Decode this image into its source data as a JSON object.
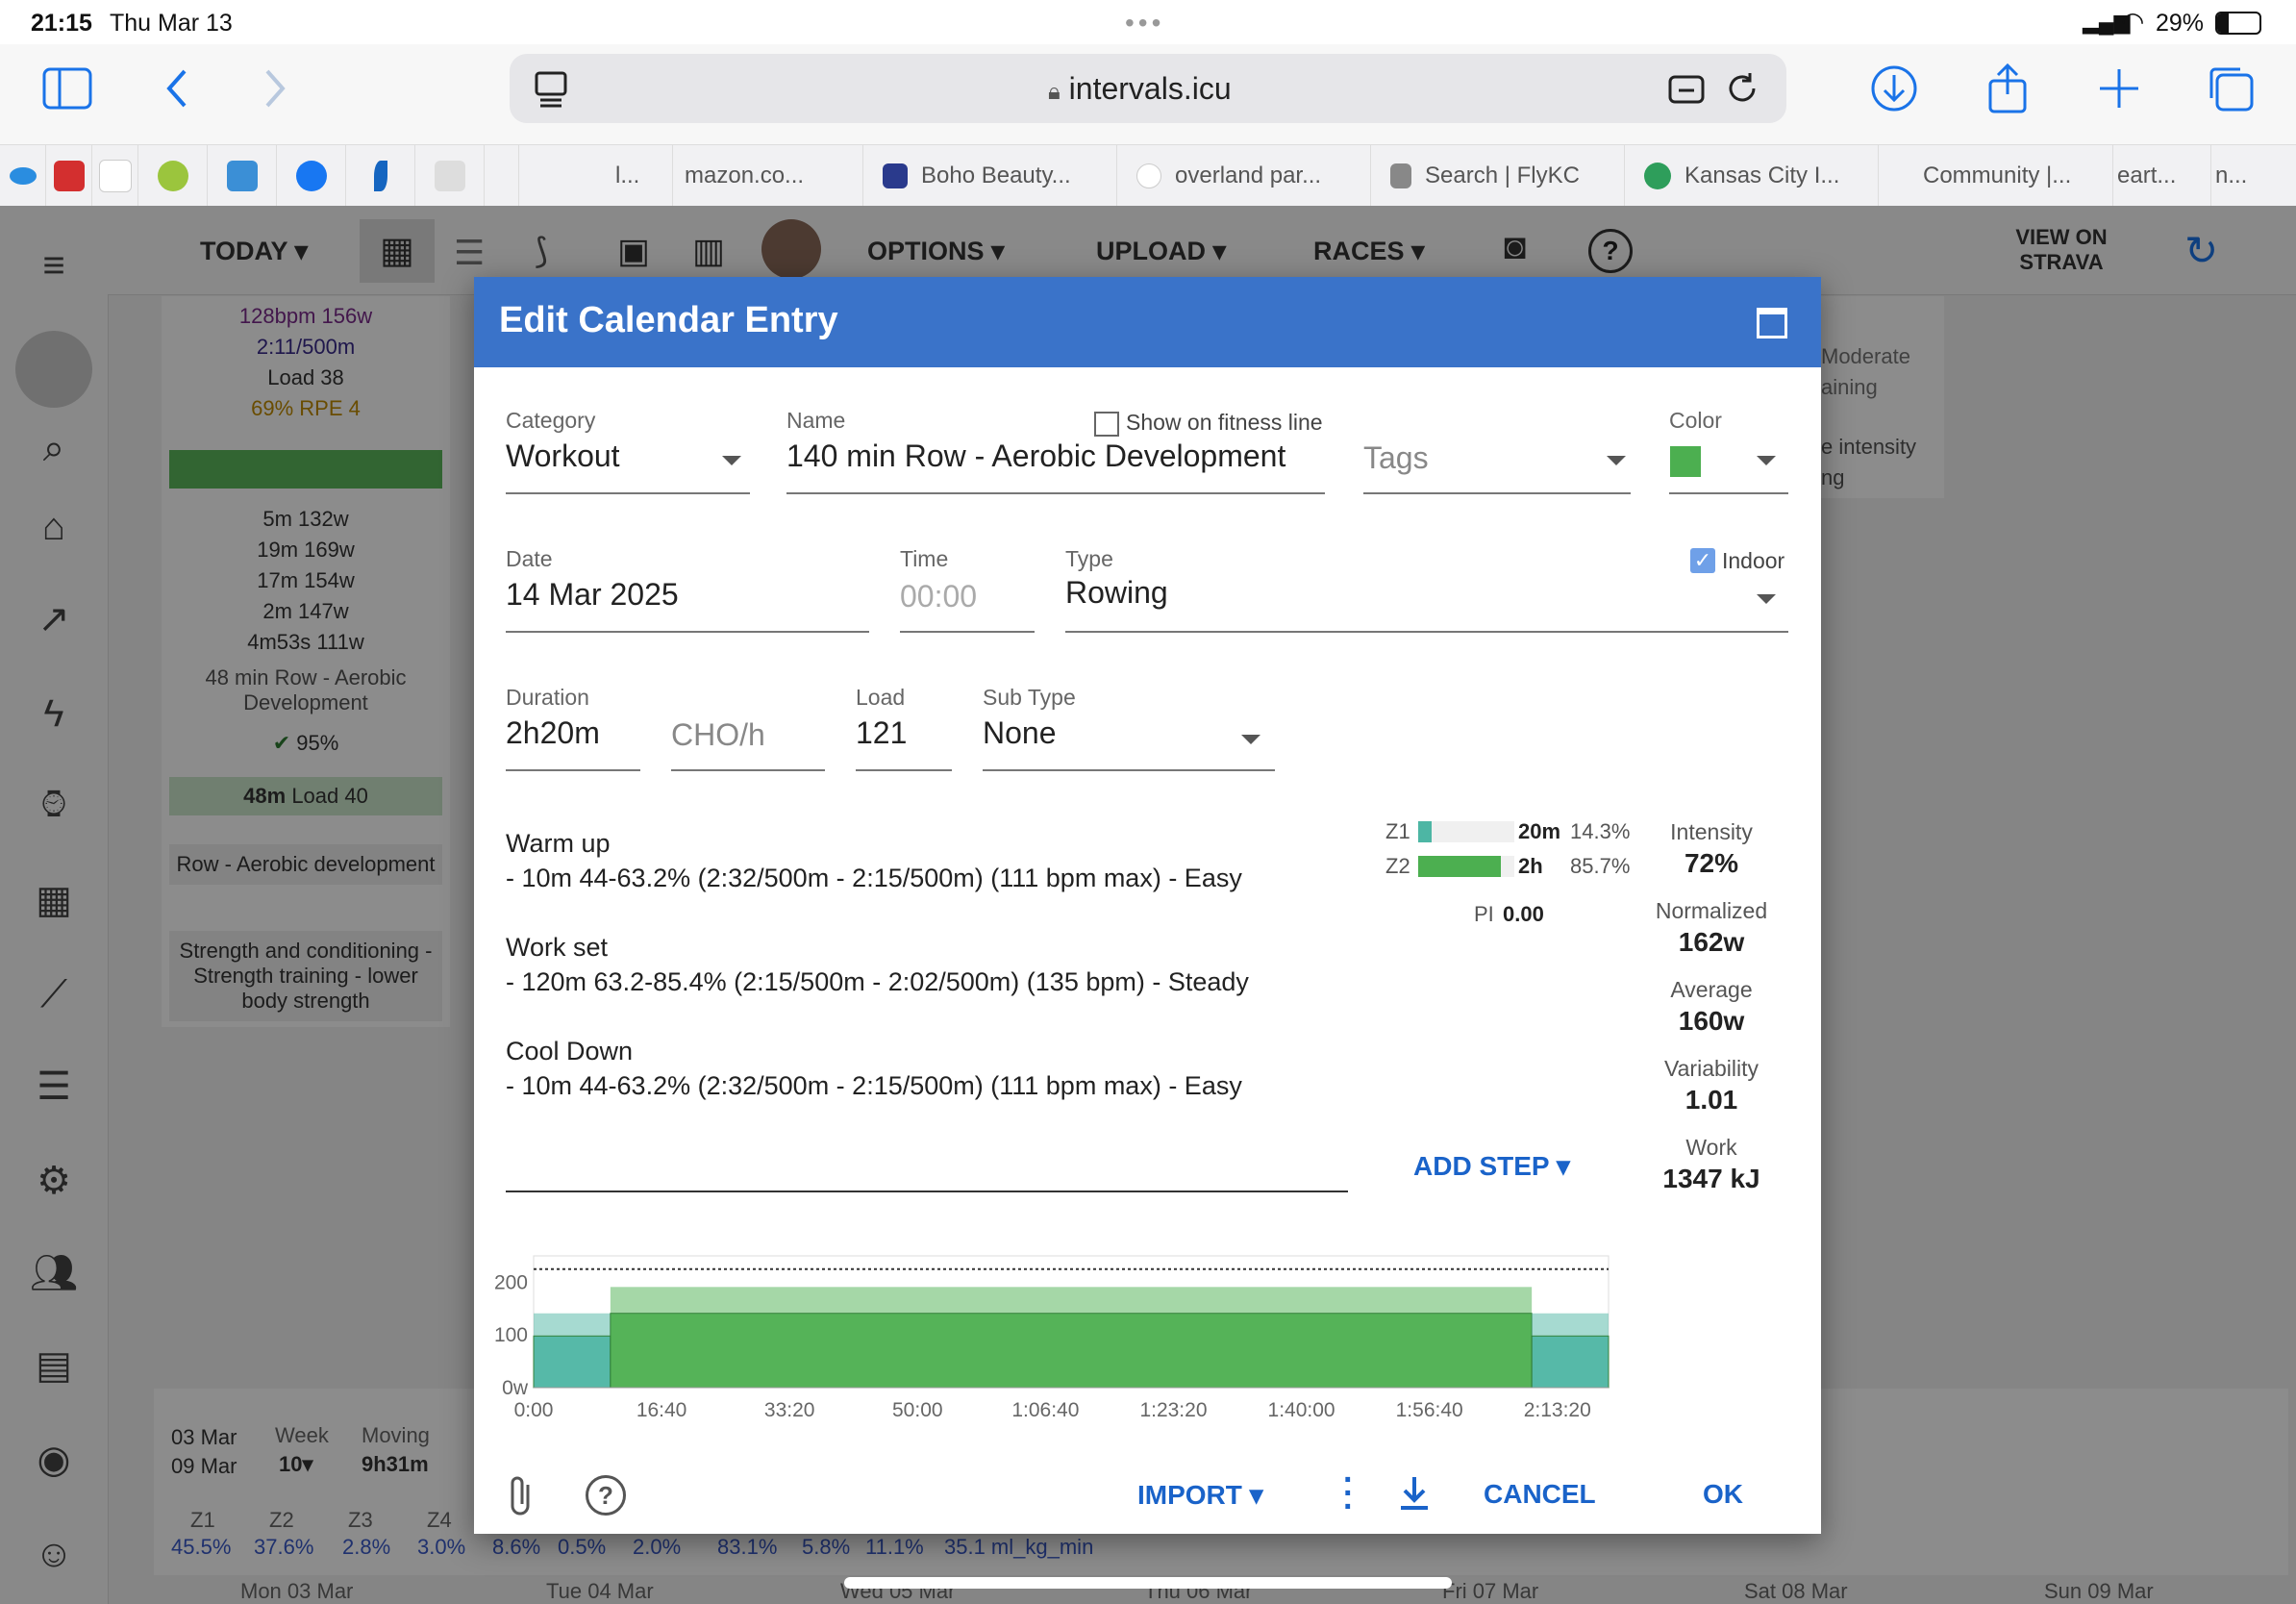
{
  "status_bar": {
    "time": "21:15",
    "date": "Thu Mar 13",
    "battery": "29%"
  },
  "browser": {
    "url": "intervals.icu"
  },
  "bookmarks": [
    {
      "label": "l..."
    },
    {
      "label": "mazon.co..."
    },
    {
      "label": "Boho Beauty..."
    },
    {
      "label": "overland par..."
    },
    {
      "label": "Search | FlyKC"
    },
    {
      "label": "Kansas City I..."
    },
    {
      "label": "Community |..."
    },
    {
      "label": "eart..."
    },
    {
      "label": "n..."
    }
  ],
  "app_header": {
    "today": "TODAY",
    "options": "OPTIONS",
    "upload": "UPLOAD",
    "races": "RACES",
    "view_on_strava": "VIEW ON STRAVA"
  },
  "background_column": {
    "hr_power": "128bpm 156w",
    "pace": "2:11/500m",
    "load": "Load 38",
    "rpe": "69% RPE 4",
    "intervals": [
      "5m 132w",
      "19m 169w",
      "17m 154w",
      "2m 147w",
      "4m53s 111w"
    ],
    "workout_title": "48 min Row - Aerobic Development",
    "compliance": "95%",
    "summary_duration": "48m",
    "summary_load": "Load 40",
    "row_title": "Row - Aerobic development",
    "strength_title": "Strength and conditioning - Strength training - lower body strength",
    "right_top": "Moderate",
    "right_top2": "aining",
    "right_mid": "e intensity",
    "right_mid2": "ng"
  },
  "week_summary": {
    "dates": "03 Mar\n09 Mar",
    "week_label": "Week",
    "week_value": "10",
    "moving_label": "Moving",
    "moving_value": "9h31m",
    "zones": [
      {
        "label": "Z1",
        "value": "45.5%"
      },
      {
        "label": "Z2",
        "value": "37.6%"
      },
      {
        "label": "Z3",
        "value": "2.8%"
      },
      {
        "label": "Z4",
        "value": "3.0%"
      }
    ],
    "extra": [
      "8.6%",
      "0.5%",
      "2.0%",
      "83.1%",
      "5.8%",
      "11.1%",
      "35.1 ml_kg_min"
    ],
    "day_headers": [
      "Mon 03 Mar",
      "Tue 04 Mar",
      "Wed 05 Mar",
      "Thu 06 Mar",
      "Fri 07 Mar",
      "Sat 08 Mar",
      "Sun 09 Mar"
    ]
  },
  "dialog": {
    "title": "Edit Calendar Entry",
    "category_label": "Category",
    "category_value": "Workout",
    "name_label": "Name",
    "name_value": "140 min Row - Aerobic Development",
    "show_fitness_label": "Show on fitness line",
    "tags_placeholder": "Tags",
    "color_label": "Color",
    "color_value": "#4caf50",
    "date_label": "Date",
    "date_value": "14 Mar 2025",
    "time_label": "Time",
    "time_placeholder": "00:00",
    "type_label": "Type",
    "type_value": "Rowing",
    "indoor_label": "Indoor",
    "duration_label": "Duration",
    "duration_value": "2h20m",
    "cho_placeholder": "CHO/h",
    "load_label": "Load",
    "load_value": "121",
    "subtype_label": "Sub Type",
    "subtype_value": "None",
    "steps": [
      {
        "title": "Warm up",
        "detail": "- 10m 44-63.2% (2:32/500m - 2:15/500m) (111 bpm max) - Easy"
      },
      {
        "title": "Work set",
        "detail": "- 120m 63.2-85.4%  (2:15/500m - 2:02/500m) (135 bpm) - Steady"
      },
      {
        "title": "Cool Down",
        "detail": "- 10m 44-63.2% (2:32/500m - 2:15/500m) (111 bpm max) - Easy"
      }
    ],
    "zones": [
      {
        "label": "Z1",
        "time": "20m",
        "pct": "14.3%",
        "fraction": 0.143,
        "color": "#4db6a4"
      },
      {
        "label": "Z2",
        "time": "2h",
        "pct": "85.7%",
        "fraction": 0.857,
        "color": "#4caf50"
      }
    ],
    "pi_label": "PI",
    "pi_value": "0.00",
    "stats": [
      {
        "label": "Intensity",
        "value": "72%"
      },
      {
        "label": "Normalized",
        "value": "162w"
      },
      {
        "label": "Average",
        "value": "160w"
      },
      {
        "label": "Variability",
        "value": "1.01"
      },
      {
        "label": "Work",
        "value": "1347 kJ"
      }
    ],
    "add_step": "ADD STEP",
    "import": "IMPORT",
    "cancel": "CANCEL",
    "ok": "OK"
  },
  "chart_data": {
    "type": "area",
    "y_ticks": [
      "200",
      "100",
      "0w"
    ],
    "x_ticks": [
      "0:00",
      "16:40",
      "33:20",
      "50:00",
      "1:06:40",
      "1:23:20",
      "1:40:00",
      "1:56:40",
      "2:13:20"
    ],
    "ylim": [
      0,
      250
    ],
    "xlim_minutes": [
      0,
      140
    ],
    "segments": [
      {
        "start_min": 0,
        "end_min": 10,
        "low": 98,
        "high": 141,
        "color": "#4db6a4"
      },
      {
        "start_min": 10,
        "end_min": 130,
        "low": 141,
        "high": 191,
        "color": "#4caf50"
      },
      {
        "start_min": 130,
        "end_min": 140,
        "low": 98,
        "high": 141,
        "color": "#4db6a4"
      }
    ],
    "threshold_line": 225
  }
}
